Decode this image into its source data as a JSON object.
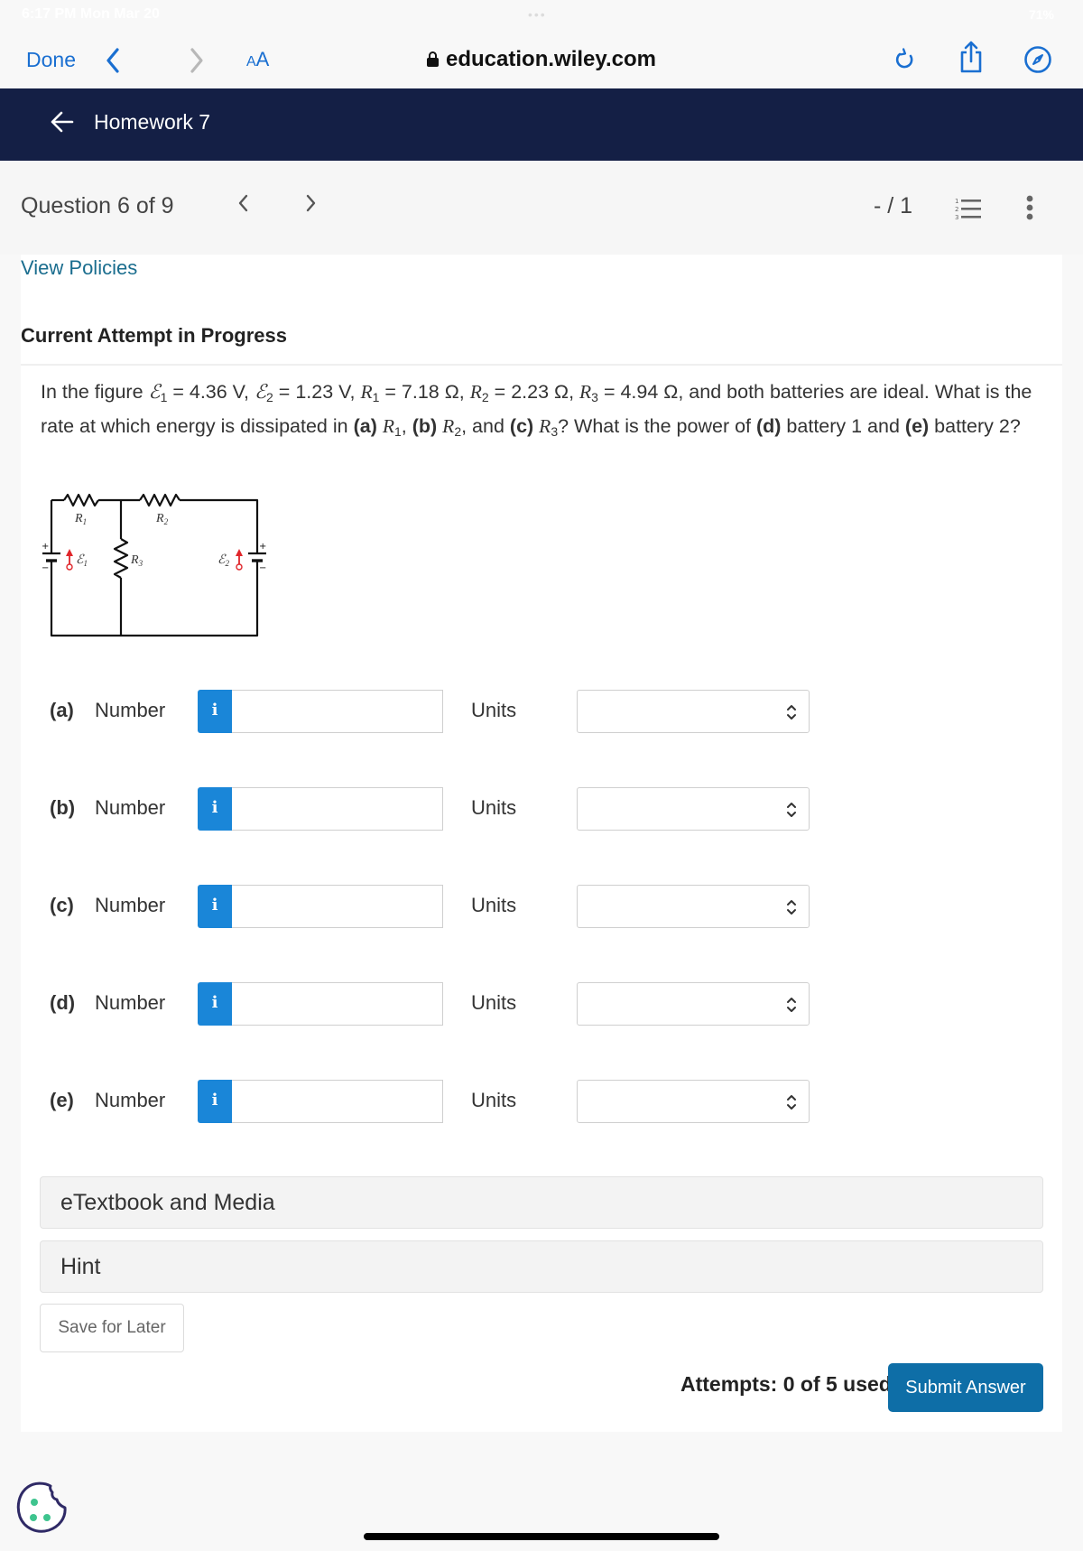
{
  "status_bar": {
    "time": "6:17 PM  Mon Mar 20",
    "dots": "•••",
    "battery": "71%"
  },
  "browser": {
    "done_label": "Done",
    "back_icon": "chevron-left-icon",
    "forward_icon": "chevron-right-icon",
    "text_size_label_small": "A",
    "text_size_label_large": "A",
    "url": "education.wiley.com",
    "lock_icon": "lock-icon",
    "reload_icon": "reload-icon",
    "share_icon": "share-icon",
    "compass_icon": "compass-icon",
    "accent_color": "#1a6fd1"
  },
  "header": {
    "back_icon": "arrow-left-icon",
    "title": "Homework 7",
    "background_color": "#141f45"
  },
  "question_nav": {
    "label": "Question 6 of 9",
    "prev": "‹",
    "next": "›",
    "score": "- / 1",
    "list_icon": "numbered-list-icon",
    "more_icon": "more-vertical-icon"
  },
  "card": {
    "view_policies": "View Policies",
    "attempt_title": "Current Attempt in Progress",
    "question": {
      "seg1": "In the figure ",
      "emf1_sym": "ℰ",
      "emf1_sub": "1",
      "emf1_val": " = 4.36 V, ",
      "emf2_sym": "ℰ",
      "emf2_sub": "2",
      "emf2_val": " = 1.23 V, ",
      "r1_sym": "R",
      "r1_sub": "1",
      "r1_val": " = 7.18 Ω, ",
      "r2_sym": "R",
      "r2_sub": "2",
      "r2_val": " = 2.23 Ω, ",
      "r3_sym": "R",
      "r3_sub": "3",
      "r3_val": " = 4.94 Ω, and both batteries are ideal. What is the rate at which energy is dissipated in ",
      "a": "(a)",
      "a_sym": "R",
      "a_sub": "1",
      "sep_ab": ", ",
      "b": "(b)",
      "b_sym": "R",
      "b_sub": "2",
      "sep_bc": ", and ",
      "c": "(c)",
      "c_sym": "R",
      "c_sub": "3",
      "after_c": "? What is the power of ",
      "d": "(d)",
      "after_d": " battery 1 and ",
      "e": "(e)",
      "after_e": " battery 2?"
    },
    "figure": {
      "labels": {
        "r1": "R",
        "r1_sub": "1",
        "r2": "R",
        "r2_sub": "2",
        "r3": "R",
        "r3_sub": "3",
        "emf1": "ℰ",
        "emf1_sub": "1",
        "emf2": "ℰ",
        "emf2_sub": "2",
        "plus": "+",
        "minus": "−"
      },
      "arrow_color": "#e0252a"
    },
    "answers": [
      {
        "part": "(a)",
        "number_label": "Number",
        "info": "i",
        "value": "",
        "units_label": "Units",
        "units_value": ""
      },
      {
        "part": "(b)",
        "number_label": "Number",
        "info": "i",
        "value": "",
        "units_label": "Units",
        "units_value": ""
      },
      {
        "part": "(c)",
        "number_label": "Number",
        "info": "i",
        "value": "",
        "units_label": "Units",
        "units_value": ""
      },
      {
        "part": "(d)",
        "number_label": "Number",
        "info": "i",
        "value": "",
        "units_label": "Units",
        "units_value": ""
      },
      {
        "part": "(e)",
        "number_label": "Number",
        "info": "i",
        "value": "",
        "units_label": "Units",
        "units_value": ""
      }
    ],
    "etextbook_label": "eTextbook and Media",
    "hint_label": "Hint",
    "save_later_label": "Save for Later",
    "attempts_label": "Attempts: 0 of 5 used",
    "submit_label": "Submit Answer",
    "info_color": "#1a86d8",
    "submit_color": "#0e6ea7",
    "link_color": "#1a6d8e"
  },
  "footer": {
    "cookie_icon": "cookie-icon"
  }
}
